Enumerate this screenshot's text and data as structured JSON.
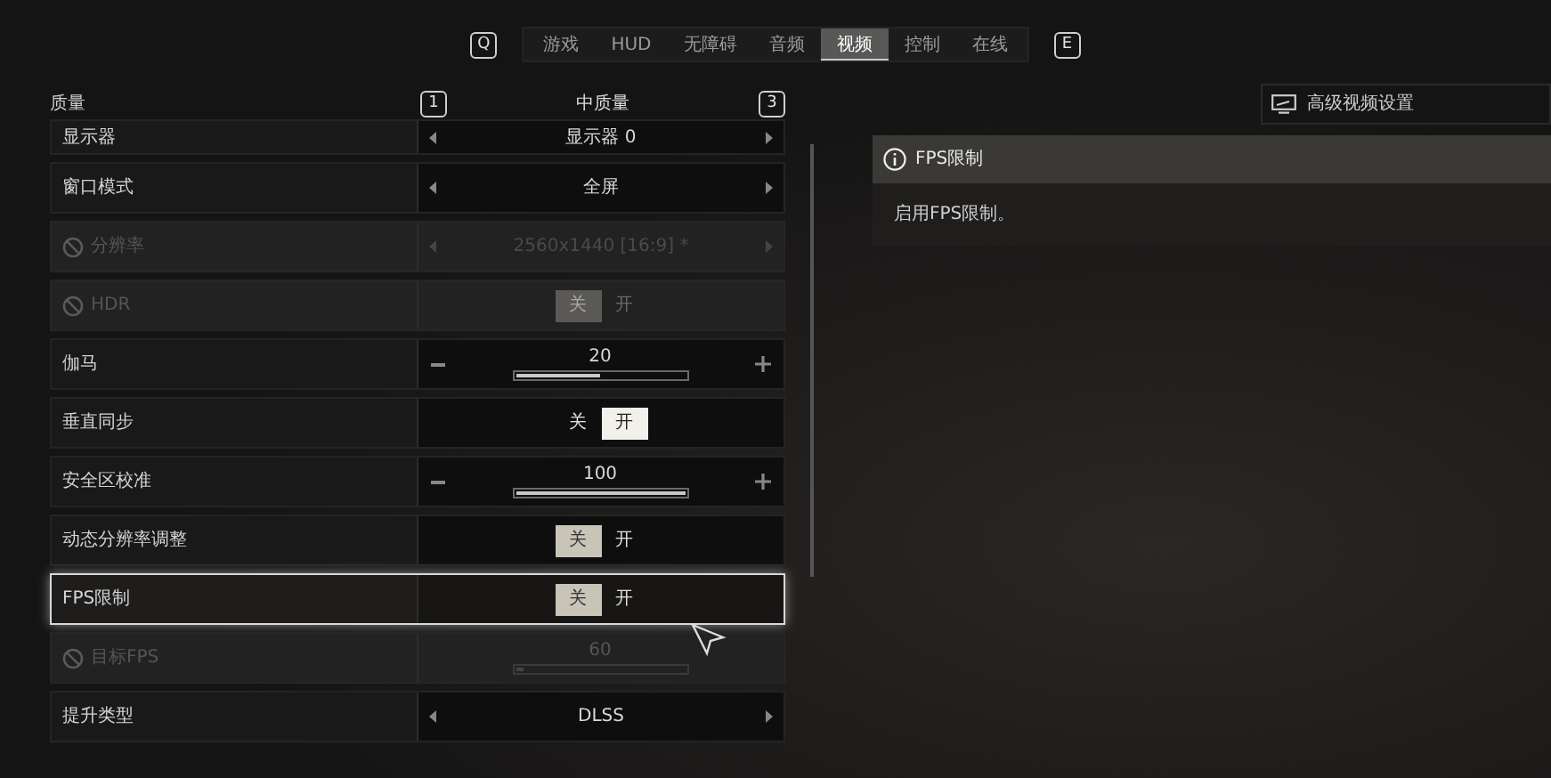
{
  "tabs": {
    "prev_key": "Q",
    "next_key": "E",
    "items": [
      {
        "label": "游戏",
        "selected": false
      },
      {
        "label": "HUD",
        "selected": false
      },
      {
        "label": "无障碍",
        "selected": false
      },
      {
        "label": "音频",
        "selected": false
      },
      {
        "label": "视频",
        "selected": true
      },
      {
        "label": "控制",
        "selected": false
      },
      {
        "label": "在线",
        "selected": false
      }
    ]
  },
  "preset": {
    "label": "质量",
    "prev_key": "1",
    "value": "中质量",
    "next_key": "3"
  },
  "advanced_button": "高级视频设置",
  "settings": [
    {
      "kind": "selector",
      "label": "显示器",
      "value": "显示器 0",
      "disabled": false,
      "highlighted": false
    },
    {
      "kind": "selector",
      "label": "窗口模式",
      "value": "全屏",
      "disabled": false,
      "highlighted": false
    },
    {
      "kind": "selector",
      "label": "分辨率",
      "value": "2560x1440 [16:9] *",
      "disabled": true,
      "highlighted": false
    },
    {
      "kind": "toggle",
      "label": "HDR",
      "off_label": "关",
      "on_label": "开",
      "on": false,
      "disabled": true,
      "highlighted": false
    },
    {
      "kind": "slider",
      "label": "伽马",
      "reading": "20",
      "level": 0.5,
      "disabled": false,
      "highlighted": false
    },
    {
      "kind": "toggle",
      "label": "垂直同步",
      "off_label": "关",
      "on_label": "开",
      "on": true,
      "disabled": false,
      "highlighted": false
    },
    {
      "kind": "slider",
      "label": "安全区校准",
      "reading": "100",
      "level": 1,
      "disabled": false,
      "highlighted": false
    },
    {
      "kind": "toggle",
      "label": "动态分辨率调整",
      "off_label": "关",
      "on_label": "开",
      "on": false,
      "disabled": false,
      "highlighted": false
    },
    {
      "kind": "toggle",
      "label": "FPS限制",
      "off_label": "关",
      "on_label": "开",
      "on": false,
      "disabled": false,
      "highlighted": true
    },
    {
      "kind": "slider",
      "label": "目标FPS",
      "reading": "60",
      "level": 0.05,
      "disabled": true,
      "highlighted": false
    },
    {
      "kind": "selector",
      "label": "提升类型",
      "value": "DLSS",
      "disabled": false,
      "highlighted": false
    }
  ],
  "info": {
    "title": "FPS限制",
    "description": "启用FPS限制。"
  }
}
